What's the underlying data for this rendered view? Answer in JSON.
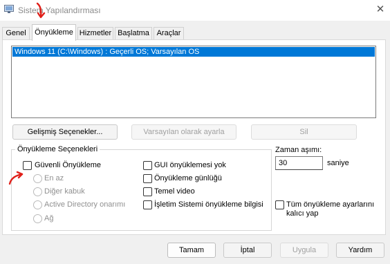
{
  "window": {
    "title": "Sistem Yapılandırması",
    "close_glyph": "✕"
  },
  "tabs": [
    {
      "label": "Genel",
      "active": false
    },
    {
      "label": "Önyükleme",
      "active": true
    },
    {
      "label": "Hizmetler",
      "active": false
    },
    {
      "label": "Başlatma",
      "active": false
    },
    {
      "label": "Araçlar",
      "active": false
    }
  ],
  "os_list": {
    "items": [
      {
        "label": "Windows 11 (C:\\Windows) : Geçerli OS; Varsayılan OS",
        "selected": true
      }
    ]
  },
  "list_buttons": {
    "advanced": "Gelişmiş Seçenekler...",
    "set_default": "Varsayılan olarak ayarla",
    "delete": "Sil"
  },
  "boot_options": {
    "group_label": "Önyükleme Seçenekleri",
    "safe_boot": {
      "label": "Güvenli Önyükleme",
      "checked": false
    },
    "radios": [
      {
        "label": "En az",
        "enabled": false
      },
      {
        "label": "Diğer kabuk",
        "enabled": false
      },
      {
        "label": "Active Directory onarımı",
        "enabled": false
      },
      {
        "label": "Ağ",
        "enabled": false
      }
    ],
    "right_checks": [
      {
        "label": "GUI önyüklemesi yok",
        "checked": false
      },
      {
        "label": "Önyükleme günlüğü",
        "checked": false
      },
      {
        "label": "Temel video",
        "checked": false
      },
      {
        "label": "İşletim Sistemi önyükleme bilgisi",
        "checked": false
      }
    ]
  },
  "timeout": {
    "label": "Zaman aşımı:",
    "value": "30",
    "unit": "saniye"
  },
  "permanent": {
    "label_line1": "Tüm önyükleme ayarlarını",
    "label_line2": "kalıcı yap",
    "checked": false
  },
  "footer": {
    "ok": "Tamam",
    "cancel": "İptal",
    "apply": "Uygula",
    "help": "Yardım"
  },
  "colors": {
    "selection": "#0078d7",
    "annotation": "#e0201a"
  }
}
